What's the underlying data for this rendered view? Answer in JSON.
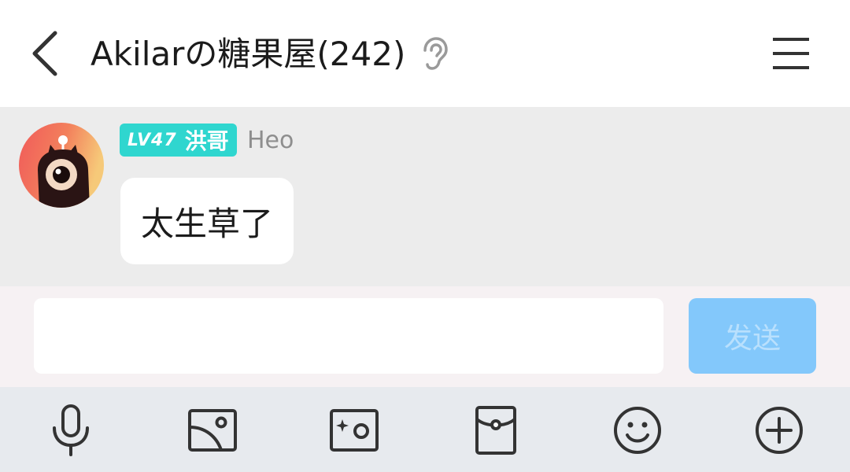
{
  "header": {
    "back_icon": "chevron-left-icon",
    "title": "Akilarの糖果屋(242)",
    "ear_icon": "ear-icon",
    "menu_icon": "hamburger-menu-icon"
  },
  "message": {
    "level": "LV47",
    "title_badge": "洪哥",
    "username": "Heo",
    "text": "太生草了",
    "badge_color": "#2fd6cf"
  },
  "composer": {
    "input_value": "",
    "send_label": "发送",
    "send_color": "#83c8fb"
  },
  "toolbar": {
    "items": [
      "microphone-icon",
      "image-icon",
      "camera-icon",
      "red-packet-icon",
      "emoji-icon",
      "add-icon"
    ]
  }
}
